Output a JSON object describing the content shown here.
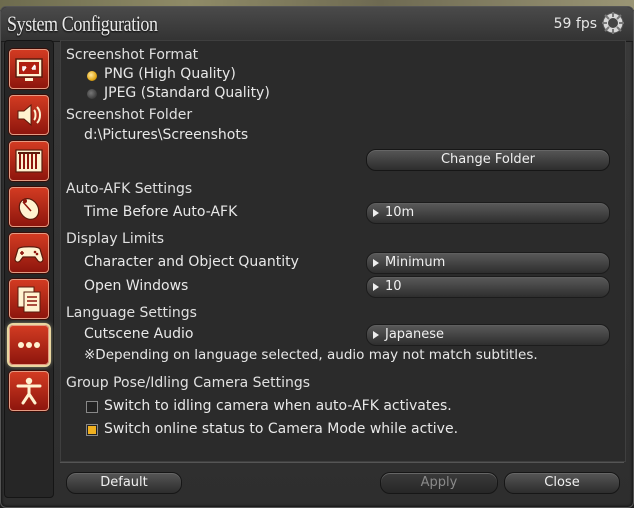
{
  "window": {
    "title": "System Configuration",
    "fps": "59 fps"
  },
  "sidebar": {
    "items": [
      {
        "icon": "display-settings-icon"
      },
      {
        "icon": "sound-icon"
      },
      {
        "icon": "theater-curtain-icon"
      },
      {
        "icon": "mouse-icon"
      },
      {
        "icon": "gamepad-icon"
      },
      {
        "icon": "documents-icon"
      },
      {
        "icon": "more-options-icon",
        "active": true
      },
      {
        "icon": "accessibility-figure-icon"
      }
    ]
  },
  "screenshot": {
    "format_label": "Screenshot Format",
    "png_label": "PNG (High Quality)",
    "jpeg_label": "JPEG (Standard Quality)",
    "selected": "PNG (High Quality)",
    "folder_label": "Screenshot Folder",
    "folder_path": "d:\\Pictures\\Screenshots",
    "change_folder": "Change Folder"
  },
  "afk": {
    "section": "Auto-AFK Settings",
    "time_label": "Time Before Auto-AFK",
    "time_value": "10m"
  },
  "limits": {
    "section": "Display Limits",
    "char_label": "Character and Object Quantity",
    "char_value": "Minimum",
    "windows_label": "Open Windows",
    "windows_value": "10"
  },
  "language": {
    "section": "Language Settings",
    "cutscene_label": "Cutscene Audio",
    "cutscene_value": "Japanese",
    "note": "※Depending on language selected, audio may not match subtitles."
  },
  "camera": {
    "section": "Group Pose/Idling Camera Settings",
    "idle_label": "Switch to idling camera when auto-AFK activates.",
    "idle_checked": false,
    "online_label": "Switch online status to Camera Mode while active.",
    "online_checked": true
  },
  "footer": {
    "default": "Default",
    "apply": "Apply",
    "close": "Close"
  },
  "colors": {
    "accent_red": "#c0301a",
    "radio_on": "#e2a818"
  }
}
